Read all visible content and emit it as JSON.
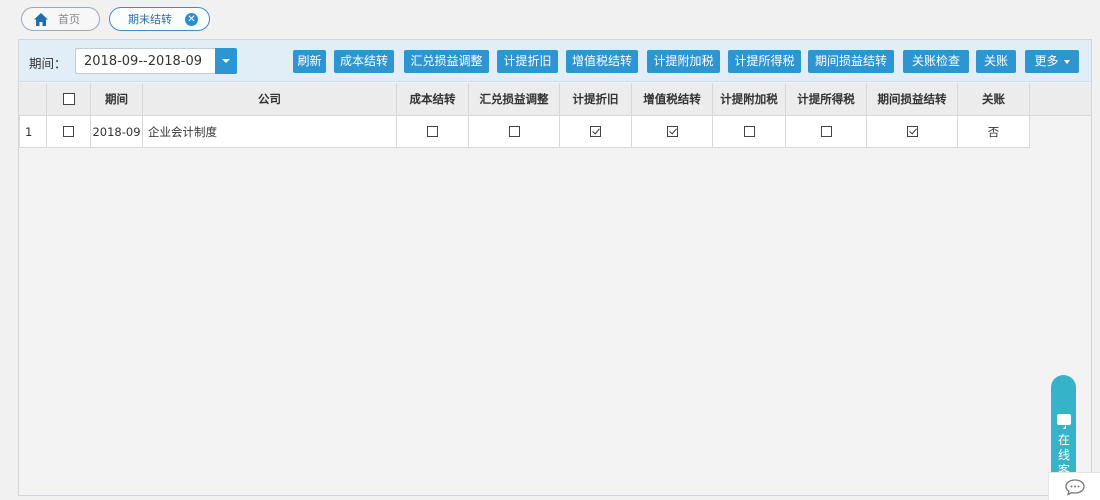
{
  "tabs": {
    "home_label": "首页",
    "active_label": "期末结转",
    "close_glyph": "✕"
  },
  "toolbar": {
    "period_label": "期间：",
    "period_value": "2018-09--2018-09",
    "buttons": [
      "刷新",
      "成本结转",
      "汇兑损益调整",
      "计提折旧",
      "增值税结转",
      "计提附加税",
      "计提所得税",
      "期间损益结转",
      "关账检查",
      "关账",
      "更多"
    ]
  },
  "table": {
    "headers": {
      "period": "期间",
      "company": "公司",
      "cost_transfer": "成本结转",
      "fx_adjust": "汇兑损益调整",
      "depreciation": "计提折旧",
      "vat_transfer": "增值税结转",
      "surtax": "计提附加税",
      "income_tax": "计提所得税",
      "pl_transfer": "期间损益结转",
      "close": "关账"
    },
    "rows": [
      {
        "index": "1",
        "selected": false,
        "period": "2018-09",
        "company": "企业会计制度",
        "cost_transfer": false,
        "fx_adjust": false,
        "depreciation": true,
        "vat_transfer": true,
        "surtax": false,
        "income_tax": false,
        "pl_transfer": true,
        "close": "否"
      }
    ]
  },
  "service": {
    "label": "在线客服"
  },
  "colors": {
    "accent": "#2e95d3",
    "toolbar_bg": "#e1eef8",
    "service": "#35b3c7"
  },
  "icons": [
    "home-icon",
    "close-icon",
    "dropdown-caret-icon",
    "chat-bubble-icon",
    "chat-icon"
  ]
}
